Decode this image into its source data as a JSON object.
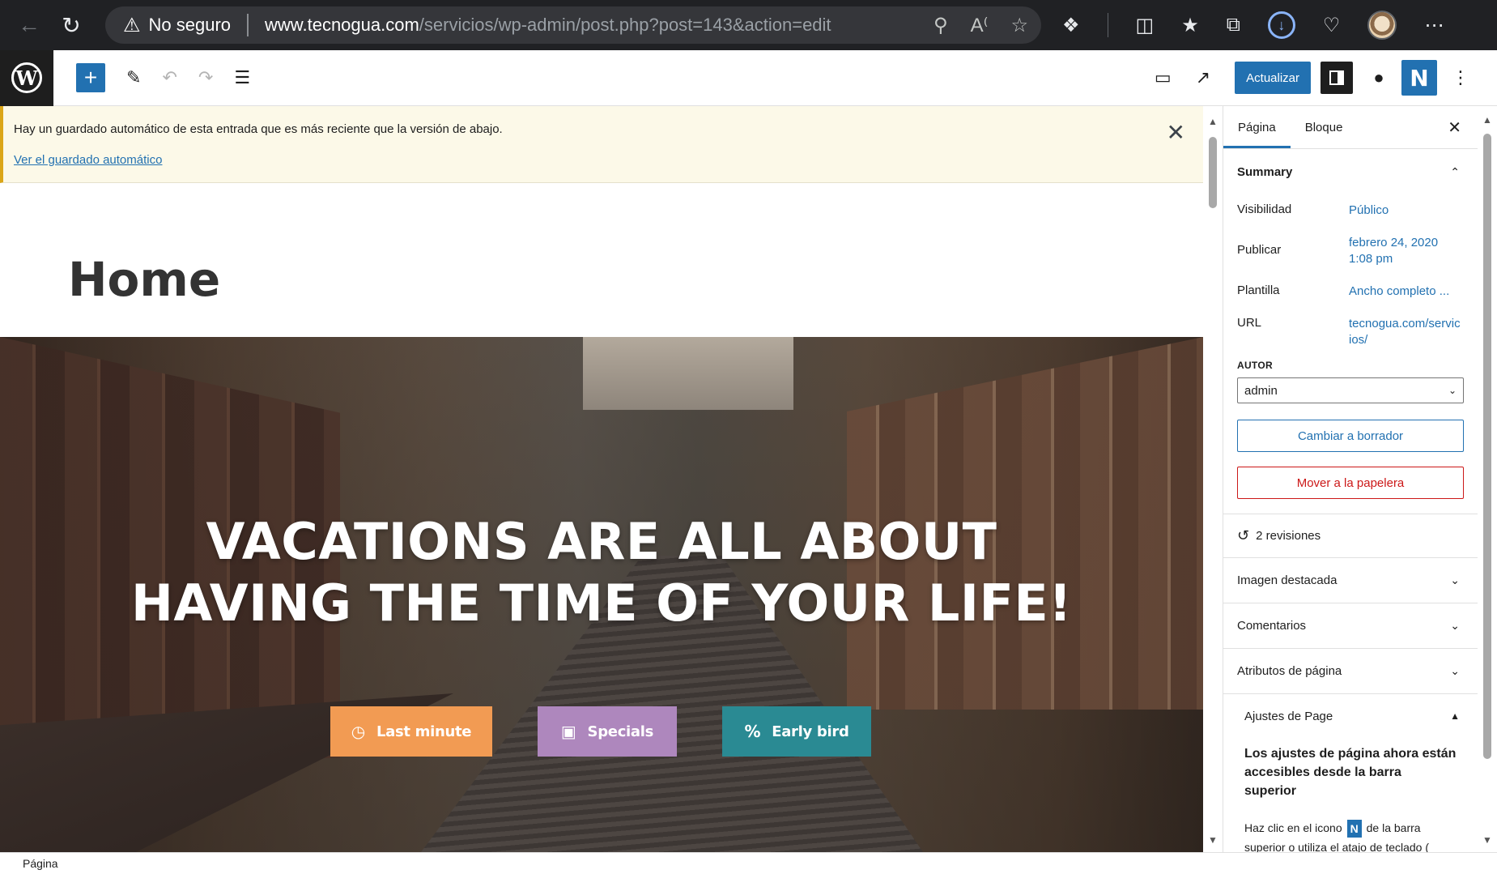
{
  "browser": {
    "security_label": "No seguro",
    "url_host": "www.tecnogua.com",
    "url_path": "/servicios/wp-admin/post.php?post=143&action=edit"
  },
  "toolbar": {
    "update_label": "Actualizar"
  },
  "notice": {
    "message": "Hay un guardado automático de esta entrada que es más reciente que la versión de abajo.",
    "link": "Ver el guardado automático"
  },
  "page": {
    "title": "Home",
    "hero_heading_line1": "VACATIONS ARE ALL ABOUT",
    "hero_heading_line2": "HAVING THE TIME OF YOUR LIFE!",
    "buttons": [
      {
        "label": "Last minute",
        "color": "#f29b53"
      },
      {
        "label": "Specials",
        "color": "#ae87bd"
      },
      {
        "label": "Early bird",
        "color": "#2a8a93"
      }
    ]
  },
  "sidebar": {
    "tabs": [
      "Página",
      "Bloque"
    ],
    "summary": {
      "heading": "Summary",
      "rows": [
        {
          "label": "Visibilidad",
          "value": "Público"
        },
        {
          "label": "Publicar",
          "value": "febrero 24, 2020 1:08 pm"
        },
        {
          "label": "Plantilla",
          "value": "Ancho completo ..."
        },
        {
          "label": "URL",
          "value": "tecnogua.com/servicios/"
        }
      ],
      "author_label": "AUTOR",
      "author_value": "admin",
      "draft_button": "Cambiar a borrador",
      "trash_button": "Mover a la papelera"
    },
    "revisions": "2 revisiones",
    "panels": [
      "Imagen destacada",
      "Comentarios",
      "Atributos de página"
    ],
    "ajustes": {
      "heading": "Ajustes de Page",
      "bold_text": "Los ajustes de página ahora están accesibles desde la barra superior",
      "help_start": "Haz clic en el icono",
      "help_end": "de la barra superior o utiliza el atajo de teclado (",
      "n_glyph": "N"
    }
  },
  "statusbar": {
    "label": "Página"
  },
  "colors": {
    "wp_blue": "#2271b1",
    "danger": "#cc1818",
    "notice_bg": "#fcf9e8"
  }
}
